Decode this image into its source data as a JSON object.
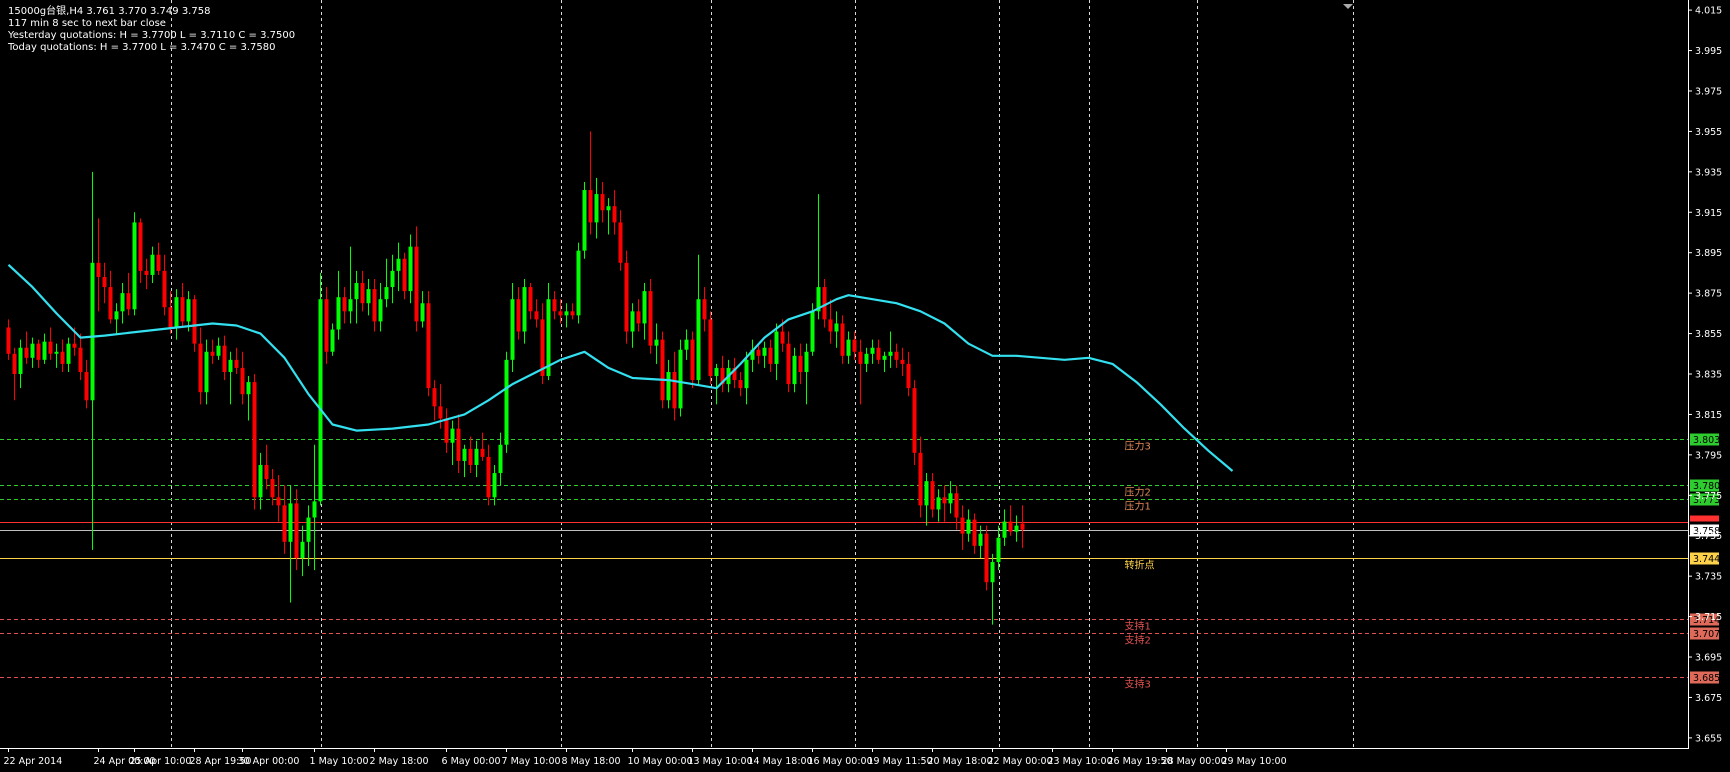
{
  "window": {
    "info_line1": "15000g台银,H4  3.761 3.770 3.749 3.758",
    "info_line2": "117 min 8 sec to next bar close",
    "info_line3": "Yesterday quotations:   H = 3.7700   L = 3.7110   C = 3.7500",
    "info_line4": "Today quotations:          H = 3.7700   L = 3.7470   C = 3.7580"
  },
  "colors": {
    "background": "#000000",
    "bull": "#00ff00",
    "bear": "#ff0000",
    "ma": "#33e0f0",
    "grid": "#ffffff",
    "resistance": "#2ecc2e",
    "support": "#e05050",
    "pivot": "#ffd24a",
    "price_line": "#ff3030"
  },
  "chart_data": {
    "type": "candlestick",
    "ylim": [
      3.65,
      4.02
    ],
    "y_ticks": [
      "4.015",
      "3.995",
      "3.975",
      "3.955",
      "3.935",
      "3.915",
      "3.895",
      "3.875",
      "3.855",
      "3.835",
      "3.815",
      "3.795",
      "3.775",
      "3.755",
      "3.735",
      "3.715",
      "3.695",
      "3.675",
      "3.655"
    ],
    "x_labels": [
      "22 Apr 2014",
      "24 Apr 00:00",
      "25 Apr 10:00",
      "28 Apr 19:50",
      "30 Apr 00:00",
      "1 May 10:00",
      "2 May 18:00",
      "6 May 00:00",
      "7 May 10:00",
      "8 May 18:00",
      "10 May 00:00",
      "13 May 10:00",
      "14 May 18:00",
      "16 May 00:00",
      "19 May 11:50",
      "20 May 18:00",
      "22 May 00:00",
      "23 May 10:00",
      "26 May 19:50",
      "28 May 00:00",
      "29 May 10:00"
    ],
    "x_label_index": [
      0,
      15,
      21,
      31,
      39,
      51,
      61,
      73,
      83,
      93,
      104,
      114,
      124,
      134,
      144,
      154,
      164,
      174,
      184,
      193,
      203
    ],
    "vertical_grid_index": [
      27,
      52,
      92,
      117,
      141,
      165,
      180,
      198,
      224
    ],
    "total_slots": 275,
    "ohlc": [
      [
        3.858,
        3.862,
        3.842,
        3.845
      ],
      [
        3.845,
        3.848,
        3.822,
        3.835
      ],
      [
        3.835,
        3.852,
        3.828,
        3.848
      ],
      [
        3.848,
        3.856,
        3.84,
        3.843
      ],
      [
        3.843,
        3.853,
        3.838,
        3.85
      ],
      [
        3.85,
        3.852,
        3.838,
        3.842
      ],
      [
        3.842,
        3.855,
        3.84,
        3.851
      ],
      [
        3.851,
        3.858,
        3.842,
        3.845
      ],
      [
        3.845,
        3.85,
        3.838,
        3.846
      ],
      [
        3.846,
        3.852,
        3.836,
        3.84
      ],
      [
        3.84,
        3.853,
        3.836,
        3.85
      ],
      [
        3.85,
        3.858,
        3.844,
        3.848
      ],
      [
        3.848,
        3.855,
        3.832,
        3.836
      ],
      [
        3.836,
        3.842,
        3.818,
        3.822
      ],
      [
        3.822,
        3.935,
        3.748,
        3.89
      ],
      [
        3.89,
        3.912,
        3.866,
        3.883
      ],
      [
        3.883,
        3.89,
        3.87,
        3.878
      ],
      [
        3.878,
        3.886,
        3.86,
        3.862
      ],
      [
        3.862,
        3.87,
        3.855,
        3.866
      ],
      [
        3.866,
        3.88,
        3.86,
        3.875
      ],
      [
        3.875,
        3.885,
        3.864,
        3.867
      ],
      [
        3.867,
        3.915,
        3.864,
        3.91
      ],
      [
        3.91,
        3.912,
        3.88,
        3.886
      ],
      [
        3.886,
        3.892,
        3.877,
        3.884
      ],
      [
        3.884,
        3.898,
        3.88,
        3.894
      ],
      [
        3.894,
        3.9,
        3.884,
        3.886
      ],
      [
        3.886,
        3.894,
        3.864,
        3.868
      ],
      [
        3.868,
        3.876,
        3.855,
        3.858
      ],
      [
        3.858,
        3.877,
        3.852,
        3.873
      ],
      [
        3.873,
        3.88,
        3.858,
        3.861
      ],
      [
        3.861,
        3.876,
        3.856,
        3.872
      ],
      [
        3.872,
        3.874,
        3.846,
        3.85
      ],
      [
        3.85,
        3.858,
        3.82,
        3.826
      ],
      [
        3.826,
        3.852,
        3.82,
        3.846
      ],
      [
        3.846,
        3.852,
        3.84,
        3.844
      ],
      [
        3.844,
        3.853,
        3.842,
        3.849
      ],
      [
        3.849,
        3.854,
        3.832,
        3.836
      ],
      [
        3.836,
        3.846,
        3.82,
        3.842
      ],
      [
        3.842,
        3.848,
        3.835,
        3.838
      ],
      [
        3.838,
        3.846,
        3.82,
        3.825
      ],
      [
        3.825,
        3.834,
        3.812,
        3.831
      ],
      [
        3.831,
        3.835,
        3.768,
        3.774
      ],
      [
        3.774,
        3.796,
        3.768,
        3.79
      ],
      [
        3.79,
        3.8,
        3.778,
        3.783
      ],
      [
        3.783,
        3.788,
        3.77,
        3.774
      ],
      [
        3.774,
        3.785,
        3.762,
        3.77
      ],
      [
        3.77,
        3.78,
        3.746,
        3.752
      ],
      [
        3.752,
        3.78,
        3.722,
        3.771
      ],
      [
        3.771,
        3.778,
        3.738,
        3.744
      ],
      [
        3.744,
        3.76,
        3.735,
        3.752
      ],
      [
        3.752,
        3.77,
        3.74,
        3.764
      ],
      [
        3.764,
        3.8,
        3.738,
        3.772
      ],
      [
        3.772,
        3.885,
        3.77,
        3.872
      ],
      [
        3.872,
        3.878,
        3.84,
        3.846
      ],
      [
        3.846,
        3.86,
        3.844,
        3.857
      ],
      [
        3.857,
        3.886,
        3.852,
        3.873
      ],
      [
        3.873,
        3.878,
        3.86,
        3.866
      ],
      [
        3.866,
        3.898,
        3.86,
        3.872
      ],
      [
        3.872,
        3.886,
        3.86,
        3.88
      ],
      [
        3.88,
        3.886,
        3.866,
        3.87
      ],
      [
        3.87,
        3.882,
        3.864,
        3.877
      ],
      [
        3.877,
        3.882,
        3.856,
        3.861
      ],
      [
        3.861,
        3.88,
        3.856,
        3.872
      ],
      [
        3.872,
        3.892,
        3.868,
        3.878
      ],
      [
        3.878,
        3.894,
        3.87,
        3.886
      ],
      [
        3.886,
        3.9,
        3.876,
        3.892
      ],
      [
        3.892,
        3.895,
        3.872,
        3.876
      ],
      [
        3.876,
        3.904,
        3.87,
        3.898
      ],
      [
        3.898,
        3.908,
        3.856,
        3.861
      ],
      [
        3.861,
        3.876,
        3.858,
        3.87
      ],
      [
        3.87,
        3.876,
        3.824,
        3.828
      ],
      [
        3.828,
        3.832,
        3.812,
        3.819
      ],
      [
        3.819,
        3.83,
        3.808,
        3.813
      ],
      [
        3.813,
        3.818,
        3.796,
        3.801
      ],
      [
        3.801,
        3.812,
        3.79,
        3.808
      ],
      [
        3.808,
        3.815,
        3.786,
        3.792
      ],
      [
        3.792,
        3.8,
        3.784,
        3.798
      ],
      [
        3.798,
        3.804,
        3.786,
        3.79
      ],
      [
        3.79,
        3.802,
        3.784,
        3.798
      ],
      [
        3.798,
        3.806,
        3.792,
        3.794
      ],
      [
        3.794,
        3.8,
        3.77,
        3.774
      ],
      [
        3.774,
        3.79,
        3.77,
        3.786
      ],
      [
        3.786,
        3.806,
        3.78,
        3.8
      ],
      [
        3.8,
        3.846,
        3.796,
        3.842
      ],
      [
        3.842,
        3.88,
        3.836,
        3.872
      ],
      [
        3.872,
        3.878,
        3.852,
        3.856
      ],
      [
        3.856,
        3.882,
        3.85,
        3.878
      ],
      [
        3.878,
        3.88,
        3.862,
        3.866
      ],
      [
        3.866,
        3.872,
        3.858,
        3.862
      ],
      [
        3.862,
        3.87,
        3.83,
        3.834
      ],
      [
        3.834,
        3.88,
        3.832,
        3.872
      ],
      [
        3.872,
        3.876,
        3.862,
        3.866
      ],
      [
        3.866,
        3.872,
        3.86,
        3.864
      ],
      [
        3.864,
        3.87,
        3.858,
        3.866
      ],
      [
        3.866,
        3.87,
        3.862,
        3.864
      ],
      [
        3.864,
        3.9,
        3.86,
        3.896
      ],
      [
        3.896,
        3.93,
        3.892,
        3.926
      ],
      [
        3.926,
        3.955,
        3.904,
        3.91
      ],
      [
        3.91,
        3.932,
        3.902,
        3.924
      ],
      [
        3.924,
        3.93,
        3.91,
        3.916
      ],
      [
        3.916,
        3.922,
        3.904,
        3.918
      ],
      [
        3.918,
        3.926,
        3.904,
        3.91
      ],
      [
        3.91,
        3.916,
        3.886,
        3.89
      ],
      [
        3.89,
        3.896,
        3.85,
        3.856
      ],
      [
        3.856,
        3.87,
        3.848,
        3.866
      ],
      [
        3.866,
        3.872,
        3.856,
        3.86
      ],
      [
        3.86,
        3.88,
        3.852,
        3.876
      ],
      [
        3.876,
        3.882,
        3.845,
        3.849
      ],
      [
        3.849,
        3.86,
        3.84,
        3.852
      ],
      [
        3.852,
        3.856,
        3.818,
        3.822
      ],
      [
        3.822,
        3.842,
        3.818,
        3.836
      ],
      [
        3.836,
        3.846,
        3.812,
        3.818
      ],
      [
        3.818,
        3.852,
        3.814,
        3.847
      ],
      [
        3.847,
        3.857,
        3.842,
        3.852
      ],
      [
        3.852,
        3.856,
        3.828,
        3.832
      ],
      [
        3.832,
        3.894,
        3.83,
        3.872
      ],
      [
        3.872,
        3.878,
        3.856,
        3.862
      ],
      [
        3.862,
        3.866,
        3.83,
        3.834
      ],
      [
        3.834,
        3.84,
        3.82,
        3.838
      ],
      [
        3.838,
        3.844,
        3.826,
        3.83
      ],
      [
        3.83,
        3.842,
        3.826,
        3.838
      ],
      [
        3.838,
        3.843,
        3.828,
        3.832
      ],
      [
        3.832,
        3.836,
        3.824,
        3.828
      ],
      [
        3.828,
        3.846,
        3.82,
        3.842
      ],
      [
        3.842,
        3.852,
        3.836,
        3.847
      ],
      [
        3.847,
        3.85,
        3.84,
        3.844
      ],
      [
        3.844,
        3.851,
        3.838,
        3.848
      ],
      [
        3.848,
        3.852,
        3.836,
        3.84
      ],
      [
        3.84,
        3.86,
        3.832,
        3.856
      ],
      [
        3.856,
        3.862,
        3.846,
        3.85
      ],
      [
        3.85,
        3.856,
        3.826,
        3.83
      ],
      [
        3.83,
        3.848,
        3.826,
        3.844
      ],
      [
        3.844,
        3.85,
        3.83,
        3.836
      ],
      [
        3.836,
        3.85,
        3.82,
        3.846
      ],
      [
        3.846,
        3.87,
        3.844,
        3.866
      ],
      [
        3.866,
        3.924,
        3.862,
        3.878
      ],
      [
        3.878,
        3.882,
        3.858,
        3.862
      ],
      [
        3.862,
        3.872,
        3.85,
        3.856
      ],
      [
        3.856,
        3.866,
        3.848,
        3.86
      ],
      [
        3.86,
        3.864,
        3.84,
        3.844
      ],
      [
        3.844,
        3.856,
        3.84,
        3.852
      ],
      [
        3.852,
        3.856,
        3.842,
        3.846
      ],
      [
        3.846,
        3.852,
        3.82,
        3.84
      ],
      [
        3.84,
        3.848,
        3.836,
        3.845
      ],
      [
        3.845,
        3.852,
        3.84,
        3.848
      ],
      [
        3.848,
        3.852,
        3.84,
        3.842
      ],
      [
        3.842,
        3.846,
        3.836,
        3.844
      ],
      [
        3.844,
        3.856,
        3.838,
        3.846
      ],
      [
        3.846,
        3.85,
        3.838,
        3.842
      ],
      [
        3.842,
        3.848,
        3.834,
        3.84
      ],
      [
        3.84,
        3.846,
        3.824,
        3.828
      ],
      [
        3.828,
        3.832,
        3.79,
        3.796
      ],
      [
        3.796,
        3.804,
        3.764,
        3.77
      ],
      [
        3.77,
        3.786,
        3.76,
        3.782
      ],
      [
        3.782,
        3.786,
        3.764,
        3.768
      ],
      [
        3.768,
        3.778,
        3.762,
        3.774
      ],
      [
        3.774,
        3.78,
        3.762,
        3.771
      ],
      [
        3.771,
        3.782,
        3.766,
        3.776
      ],
      [
        3.776,
        3.78,
        3.758,
        3.764
      ],
      [
        3.764,
        3.77,
        3.748,
        3.756
      ],
      [
        3.756,
        3.768,
        3.752,
        3.763
      ],
      [
        3.763,
        3.766,
        3.746,
        3.75
      ],
      [
        3.75,
        3.76,
        3.744,
        3.756
      ],
      [
        3.756,
        3.76,
        3.728,
        3.732
      ],
      [
        3.732,
        3.746,
        3.711,
        3.742
      ],
      [
        3.742,
        3.76,
        3.738,
        3.754
      ],
      [
        3.754,
        3.768,
        3.75,
        3.762
      ],
      [
        3.762,
        3.77,
        3.755,
        3.757
      ],
      [
        3.757,
        3.765,
        3.752,
        3.76
      ],
      [
        3.761,
        3.77,
        3.749,
        3.758
      ]
    ],
    "ma_points": [
      [
        0,
        3.889
      ],
      [
        4,
        3.878
      ],
      [
        8,
        3.865
      ],
      [
        12,
        3.853
      ],
      [
        16,
        3.854
      ],
      [
        22,
        3.856
      ],
      [
        28,
        3.858
      ],
      [
        34,
        3.86
      ],
      [
        38,
        3.859
      ],
      [
        42,
        3.855
      ],
      [
        46,
        3.843
      ],
      [
        50,
        3.825
      ],
      [
        54,
        3.81
      ],
      [
        58,
        3.807
      ],
      [
        64,
        3.808
      ],
      [
        70,
        3.81
      ],
      [
        76,
        3.815
      ],
      [
        80,
        3.822
      ],
      [
        84,
        3.83
      ],
      [
        88,
        3.836
      ],
      [
        92,
        3.842
      ],
      [
        96,
        3.846
      ],
      [
        100,
        3.838
      ],
      [
        104,
        3.833
      ],
      [
        110,
        3.832
      ],
      [
        114,
        3.83
      ],
      [
        118,
        3.828
      ],
      [
        122,
        3.84
      ],
      [
        126,
        3.853
      ],
      [
        130,
        3.862
      ],
      [
        134,
        3.866
      ],
      [
        138,
        3.872
      ],
      [
        140,
        3.874
      ],
      [
        144,
        3.872
      ],
      [
        148,
        3.87
      ],
      [
        152,
        3.866
      ],
      [
        156,
        3.86
      ],
      [
        160,
        3.85
      ],
      [
        164,
        3.844
      ],
      [
        168,
        3.844
      ],
      [
        172,
        3.843
      ],
      [
        176,
        3.842
      ],
      [
        180,
        3.843
      ],
      [
        184,
        3.84
      ],
      [
        188,
        3.831
      ],
      [
        192,
        3.82
      ],
      [
        196,
        3.808
      ],
      [
        200,
        3.797
      ],
      [
        204,
        3.787
      ]
    ],
    "levels": [
      {
        "name": "压力3",
        "value": 3.803,
        "tag": "3.803",
        "kind": "resistance"
      },
      {
        "name": "压力2",
        "value": 3.78,
        "tag": "3.780",
        "kind": "resistance"
      },
      {
        "name": "压力1",
        "value": 3.773,
        "tag": "3.773",
        "kind": "resistance"
      },
      {
        "name": "转折点",
        "value": 3.744,
        "tag": "3.744",
        "kind": "pivot"
      },
      {
        "name": "支持1",
        "value": 3.714,
        "tag": "3.714",
        "kind": "support"
      },
      {
        "name": "支持2",
        "value": 3.707,
        "tag": "3.707",
        "kind": "support"
      },
      {
        "name": "支持3",
        "value": 3.685,
        "tag": "3.685",
        "kind": "support"
      }
    ],
    "current_price": "3.758",
    "current_value": 3.758,
    "ask_value": 3.761
  }
}
